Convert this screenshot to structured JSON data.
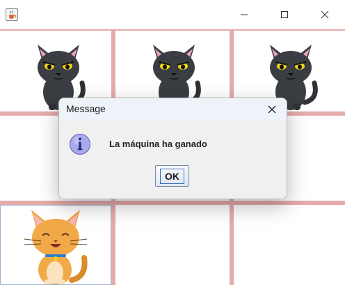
{
  "window": {
    "app_icon": "java-cup-icon",
    "controls": [
      "minimize-icon",
      "maximize-icon",
      "close-icon"
    ]
  },
  "board": {
    "rows": 3,
    "cols": 3,
    "cells": [
      [
        "black-cat",
        "black-cat",
        "black-cat"
      ],
      [
        "empty",
        "empty",
        "empty"
      ],
      [
        "orange-cat",
        "empty",
        "empty"
      ]
    ],
    "selected_cell": [
      2,
      0
    ]
  },
  "dialog": {
    "title": "Message",
    "message": "La máquina ha ganado",
    "button_label": "OK",
    "icon": "info-icon"
  },
  "colors": {
    "grid_line": "#e5aaaa",
    "dialog_title_bar": "#eef3fa",
    "dialog_body": "#f0f0f0",
    "info_icon": "#7f7fd9"
  }
}
